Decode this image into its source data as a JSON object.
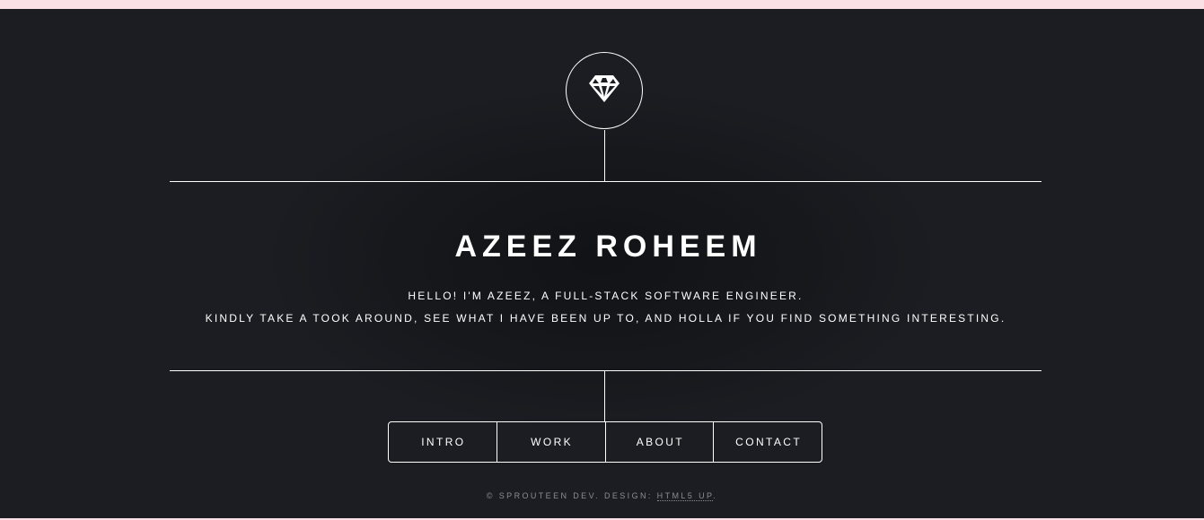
{
  "header": {
    "logo_icon": "diamond-icon",
    "name": "AZEEZ ROHEEM",
    "intro_line1": "HELLO! I'M AZEEZ, A FULL-STACK SOFTWARE ENGINEER.",
    "intro_line2": "KINDLY TAKE A TOOK AROUND, SEE WHAT I HAVE BEEN UP TO, AND HOLLA IF YOU FIND SOMETHING INTERESTING."
  },
  "nav": {
    "items": [
      {
        "label": "INTRO"
      },
      {
        "label": "WORK"
      },
      {
        "label": "ABOUT"
      },
      {
        "label": "CONTACT"
      }
    ]
  },
  "footer": {
    "copyright": "© SPROUTEEN DEV. DESIGN: ",
    "design_link": "HTML5 UP",
    "end": "."
  },
  "colors": {
    "background": "#1b1d22",
    "foreground": "#ffffff",
    "top_strip": "#f9e1e6"
  }
}
